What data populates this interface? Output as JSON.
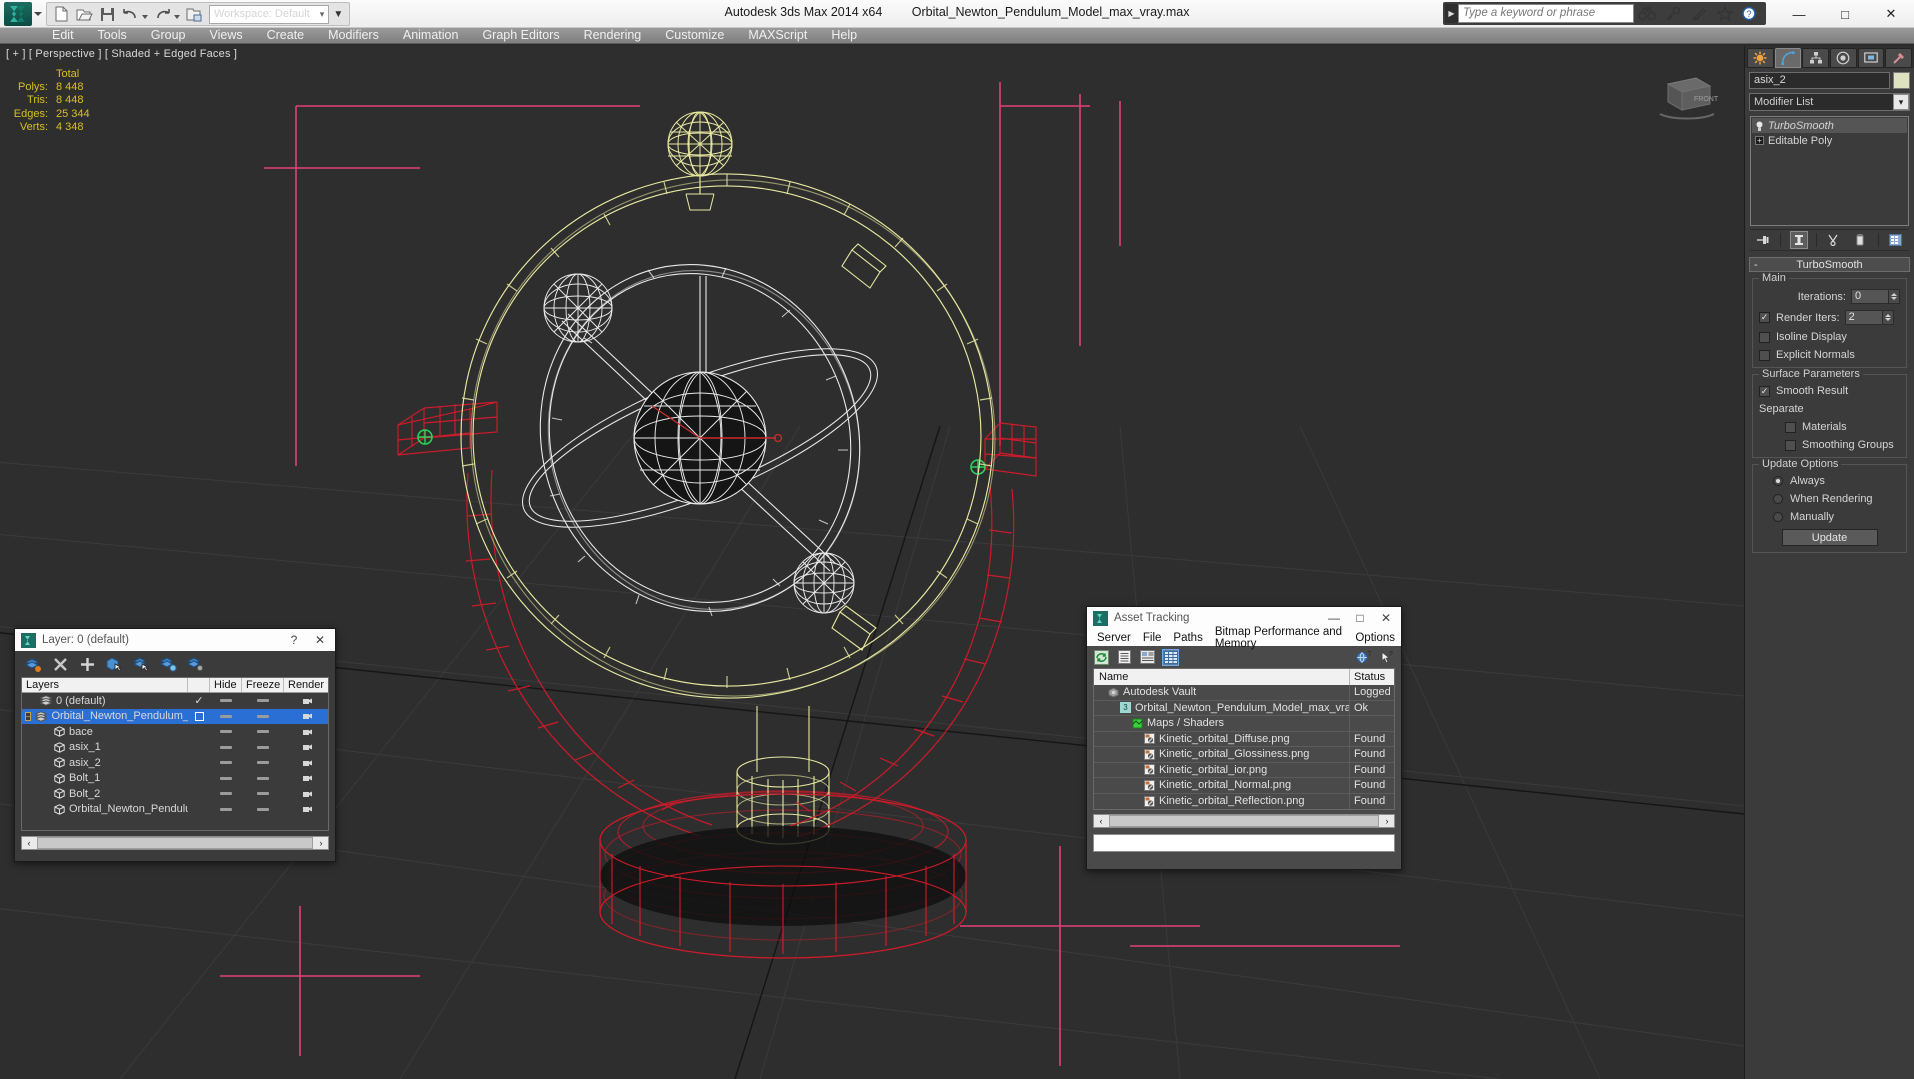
{
  "titlebar": {
    "app_title": "Autodesk 3ds Max  2014 x64",
    "file_name": "Orbital_Newton_Pendulum_Model_max_vray.max",
    "workspace_label": "Workspace: Default",
    "search_placeholder": "Type a keyword or phrase",
    "quick_access": [
      {
        "name": "new-file-icon"
      },
      {
        "name": "open-file-icon"
      },
      {
        "name": "save-file-icon"
      },
      {
        "name": "undo-icon"
      },
      {
        "name": "redo-icon"
      },
      {
        "name": "set-project-folder-icon"
      }
    ],
    "search_icons": [
      {
        "name": "binoculars-icon"
      },
      {
        "name": "key-icon"
      },
      {
        "name": "satellite-dish-icon"
      },
      {
        "name": "favorites-star-icon"
      },
      {
        "name": "help-question-icon"
      }
    ],
    "window_buttons": {
      "minimize": "—",
      "maximize": "□",
      "close": "✕"
    }
  },
  "menu": {
    "items": [
      "Edit",
      "Tools",
      "Group",
      "Views",
      "Create",
      "Modifiers",
      "Animation",
      "Graph Editors",
      "Rendering",
      "Customize",
      "MAXScript",
      "Help"
    ]
  },
  "viewport": {
    "label": "[ + ] [ Perspective ] [ Shaded + Edged Faces ]",
    "stats": {
      "header": "Total",
      "rows": [
        {
          "key": "Polys:",
          "value": "8 448"
        },
        {
          "key": "Tris:",
          "value": "8 448"
        },
        {
          "key": "Edges:",
          "value": "25 344"
        },
        {
          "key": "Verts:",
          "value": "4 348"
        }
      ]
    },
    "viewcube_label": "FRONT"
  },
  "command_panel": {
    "tabs": [
      {
        "name": "create-tab",
        "icon": "star-burst-icon",
        "active": false
      },
      {
        "name": "modify-tab",
        "icon": "bent-arrow-icon",
        "active": true
      },
      {
        "name": "hierarchy-tab",
        "icon": "hierarchy-icon",
        "active": false
      },
      {
        "name": "motion-tab",
        "icon": "motion-wheel-icon",
        "active": false
      },
      {
        "name": "display-tab",
        "icon": "display-monitor-icon",
        "active": false
      },
      {
        "name": "utilities-tab",
        "icon": "hammer-icon",
        "active": false
      }
    ],
    "object_name": "asix_2",
    "object_color": "#dfe2c0",
    "modifier_list_label": "Modifier List",
    "stack": [
      {
        "label": "TurboSmooth",
        "selected": true,
        "italic": true
      },
      {
        "label": "Editable Poly",
        "selected": false,
        "italic": false
      }
    ],
    "stack_tools": [
      {
        "name": "pin-stack-icon"
      },
      {
        "name": "show-end-result-icon",
        "active": true
      },
      {
        "name": "make-unique-icon"
      },
      {
        "name": "remove-modifier-icon"
      },
      {
        "name": "configure-modifier-sets-icon"
      }
    ],
    "rollout": {
      "title": "TurboSmooth",
      "collapse_glyph": "-",
      "main": {
        "title": "Main",
        "iterations_label": "Iterations:",
        "iterations_value": "0",
        "render_iters_label": "Render Iters:",
        "render_iters_value": "2",
        "render_iters_checked": true,
        "isoline_display_label": "Isoline Display",
        "isoline_display_checked": false,
        "explicit_normals_label": "Explicit Normals",
        "explicit_normals_checked": false
      },
      "surface": {
        "title": "Surface Parameters",
        "smooth_result_label": "Smooth Result",
        "smooth_result_checked": true,
        "separate_label": "Separate",
        "materials_label": "Materials",
        "materials_checked": false,
        "smoothing_groups_label": "Smoothing Groups",
        "smoothing_groups_checked": false
      },
      "update": {
        "title": "Update Options",
        "options": [
          {
            "label": "Always",
            "selected": true
          },
          {
            "label": "When Rendering",
            "selected": false
          },
          {
            "label": "Manually",
            "selected": false
          }
        ],
        "update_button": "Update"
      }
    }
  },
  "layer_dialog": {
    "title": "Layer: 0 (default)",
    "help_glyph": "?",
    "close_glyph": "✕",
    "tools": [
      {
        "name": "create-new-layer-icon"
      },
      {
        "name": "delete-layer-icon"
      },
      {
        "name": "add-selection-to-layer-icon"
      },
      {
        "name": "select-objects-in-layer-icon"
      },
      {
        "name": "select-highlighted-objects-icon"
      },
      {
        "name": "highlight-selected-objects-icon"
      },
      {
        "name": "layer-properties-icon"
      }
    ],
    "columns": [
      "Layers",
      "",
      "Hide",
      "Freeze",
      "Render"
    ],
    "rows": [
      {
        "label": "0 (default)",
        "type": "layer",
        "indent": 1,
        "selected": false,
        "current": true,
        "expandable": false
      },
      {
        "label": "Orbital_Newton_Pendulum_Model",
        "type": "layer",
        "indent": 0,
        "selected": true,
        "current": false,
        "expandable": true
      },
      {
        "label": "bace",
        "type": "object",
        "indent": 2,
        "selected": false,
        "current": false,
        "expandable": false
      },
      {
        "label": "asix_1",
        "type": "object",
        "indent": 2,
        "selected": false,
        "current": false,
        "expandable": false
      },
      {
        "label": "asix_2",
        "type": "object",
        "indent": 2,
        "selected": false,
        "current": false,
        "expandable": false
      },
      {
        "label": "Bolt_1",
        "type": "object",
        "indent": 2,
        "selected": false,
        "current": false,
        "expandable": false
      },
      {
        "label": "Bolt_2",
        "type": "object",
        "indent": 2,
        "selected": false,
        "current": false,
        "expandable": false
      },
      {
        "label": "Orbital_Newton_Pendulum_Model",
        "type": "object",
        "indent": 2,
        "selected": false,
        "current": false,
        "expandable": false
      }
    ],
    "scroll_left_glyph": "‹",
    "scroll_right_glyph": "›"
  },
  "asset_tracking": {
    "title": "Asset Tracking",
    "window_buttons": {
      "minimize": "—",
      "maximize": "□",
      "close": "✕"
    },
    "menu": [
      "Server",
      "File",
      "Paths",
      "Bitmap Performance and Memory",
      "Options"
    ],
    "tools": [
      {
        "name": "refresh-icon",
        "selected": false
      },
      {
        "name": "list-view-icon",
        "selected": false
      },
      {
        "name": "details-view-icon",
        "selected": false
      },
      {
        "name": "grid-view-icon",
        "selected": true
      }
    ],
    "right_tools": [
      {
        "name": "help-globe-icon"
      },
      {
        "name": "help-pointer-icon"
      }
    ],
    "columns": [
      "Name",
      "Status"
    ],
    "rows": [
      {
        "name": "Autodesk Vault",
        "status": "Logged",
        "indent": 1,
        "icon": "vault-icon"
      },
      {
        "name": "Orbital_Newton_Pendulum_Model_max_vray.max",
        "status": "Ok",
        "indent": 2,
        "icon": "max-file-icon"
      },
      {
        "name": "Maps / Shaders",
        "status": "",
        "indent": 3,
        "icon": "maps-shaders-icon"
      },
      {
        "name": "Kinetic_orbital_Diffuse.png",
        "status": "Found",
        "indent": 4,
        "icon": "bitmap-icon"
      },
      {
        "name": "Kinetic_orbital_Glossiness.png",
        "status": "Found",
        "indent": 4,
        "icon": "bitmap-icon"
      },
      {
        "name": "Kinetic_orbital_ior.png",
        "status": "Found",
        "indent": 4,
        "icon": "bitmap-icon"
      },
      {
        "name": "Kinetic_orbital_Normal.png",
        "status": "Found",
        "indent": 4,
        "icon": "bitmap-icon"
      },
      {
        "name": "Kinetic_orbital_Reflection.png",
        "status": "Found",
        "indent": 4,
        "icon": "bitmap-icon"
      }
    ],
    "scroll_left_glyph": "‹",
    "scroll_right_glyph": "›"
  },
  "colors": {
    "wire_yellow": "#e8e8a0",
    "wire_white": "#e9e9e9",
    "wire_red": "#d01b2a",
    "wire_pink": "#e0417a",
    "stats_yellow": "#d7c020",
    "viewport_bg": "#2e2e2e",
    "selection_blue": "#2a6fd4"
  }
}
